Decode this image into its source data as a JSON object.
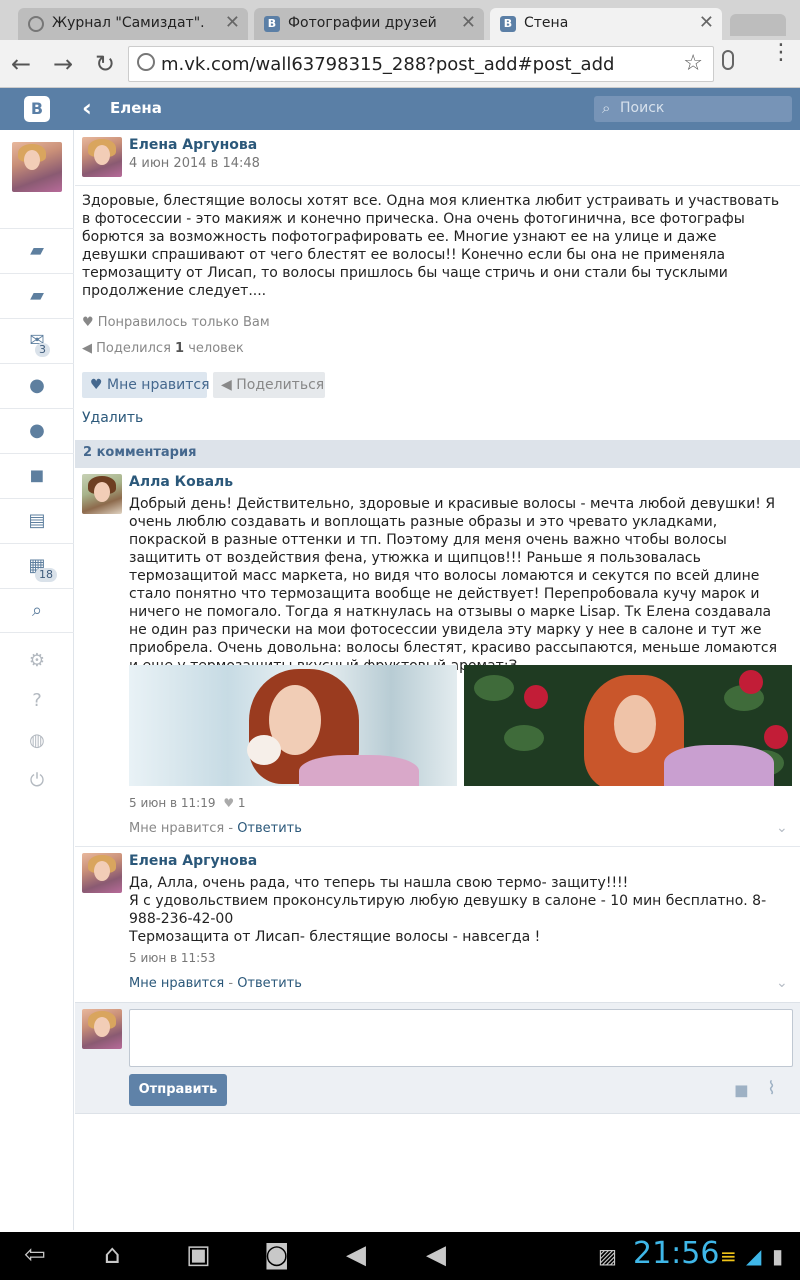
{
  "browser": {
    "tabs": [
      {
        "label": "Журнал \"Самиздат\".",
        "icon": "globe-icon"
      },
      {
        "label": "Фотографии друзей",
        "icon": "vk-icon"
      },
      {
        "label": "Стена",
        "icon": "vk-icon"
      }
    ],
    "url": "m.vk.com/wall63798315_288?post_add#post_add"
  },
  "header": {
    "logo": "В",
    "title": "Елена",
    "search_placeholder": "Поиск"
  },
  "sidebar": {
    "messages_badge": "3",
    "events_badge": "18"
  },
  "post": {
    "author": "Елена Аргунова",
    "date": "4 июн 2014 в 14:48",
    "text": "Здоровые, блестящие волосы хотят все. Одна моя клиентка любит устраивать и участвовать в фотосессии - это макияж и конечно прическа. Она очень фотогинична, все фотографы борются за возможность пофотографировать ее. Многие узнают ее на улице и даже девушки спрашивают от чего блестят ее волосы!! Конечно если бы она не применяла термозащиту от Лисап, то волосы пришлось бы чаще стричь и они стали бы тусклыми\nпродолжение следует....",
    "likes_text": "Понравилось только Вам",
    "shares_prefix": "Поделился",
    "shares_count": "1",
    "shares_suffix": "человек",
    "like_button": "Мне нравится",
    "share_button": "Поделиться",
    "delete_link": "Удалить"
  },
  "comments": {
    "header": "2 комментария",
    "items": [
      {
        "author": "Алла Коваль",
        "text": "Добрый день! Действительно, здоровые и красивые волосы - мечта любой девушки! Я очень люблю создавать и воплощать разные образы и это чревато укладками, покраской в разные оттенки и тп. Поэтому для меня очень важно чтобы волосы защитить от воздействия фена, утюжка и щипцов!!! Раньше я пользовалась термозащитой масс маркета, но видя что волосы ломаются и секутся по всей длине стало понятно что термозащита вообще не действует! Перепробовала кучу марок и ничего не помогало. Тогда я наткнулась на отзывы о марке Lisap. Тк Елена создавала не один раз прически на мои фотосессии увидела эту марку у нее в салоне и тут же приобрела. Очень довольна: волосы блестят, красиво рассыпаются, меньше ломаются и еще у термозащиты вкусный фруктовый аромат:З",
        "date": "5 июн в 11:19",
        "likes": "1",
        "like_link": "Мне нравится",
        "separator": " - ",
        "reply_link": "Ответить"
      },
      {
        "author": "Елена Аргунова",
        "text": "Да, Алла, очень рада, что теперь ты нашла свою термо- защиту!!!!\nЯ с удовольствием проконсультирую любую девушку в салоне - 10 мин бесплатно. 8-988-236-42-00\nТермозащита от Лисап- блестящие волосы - навсегда !",
        "date": "5 июн в 11:53",
        "like_link": "Мне нравится",
        "separator": " - ",
        "reply_link": "Ответить"
      }
    ]
  },
  "composer": {
    "send_button": "Отправить"
  },
  "system": {
    "clock": "21:56"
  },
  "colors": {
    "vk_header": "#5a7fa6",
    "link": "#2b587a",
    "clock": "#3fb7e8"
  }
}
